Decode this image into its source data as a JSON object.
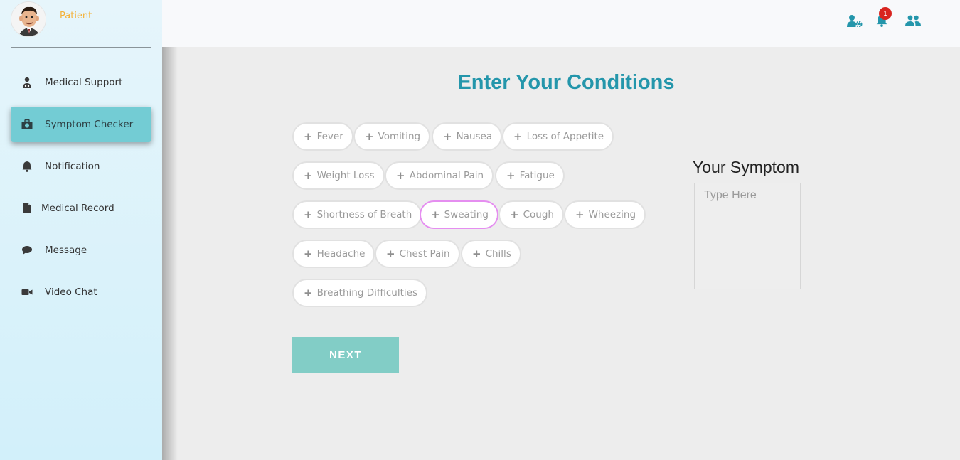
{
  "profile": {
    "name": "Patient",
    "avatar_icon": "avatar-portrait"
  },
  "sidebar": {
    "items": [
      {
        "label": "Medical Support",
        "icon": "doctor-icon"
      },
      {
        "label": "Symptom Checker",
        "icon": "medkit-icon",
        "active": true
      },
      {
        "label": "Notification",
        "icon": "bell-icon"
      },
      {
        "label": "Medical Record",
        "icon": "file-icon"
      },
      {
        "label": "Message",
        "icon": "chat-bubble-icon"
      },
      {
        "label": "Video Chat",
        "icon": "video-camera-icon"
      }
    ]
  },
  "topbar": {
    "icons": [
      "user-settings-icon",
      "bell-icon",
      "users-icon"
    ],
    "notification_count": "1"
  },
  "main": {
    "title": "Enter Your Conditions",
    "conditions": [
      "Fever",
      "Vomiting",
      "Nausea",
      "Loss of Appetite",
      "Weight Loss",
      "Abdominal Pain",
      "Fatigue",
      "Shortness of Breath",
      "Sweating",
      "Cough",
      "Wheezing",
      "Headache",
      "Chest Pain",
      "Chills",
      "Breathing Difficulties"
    ],
    "selected_condition": "Sweating",
    "next_label": "NEXT"
  },
  "symptom": {
    "label": "Your Symptom",
    "placeholder": "Type Here",
    "value": ""
  },
  "colors": {
    "accent": "#2496ab",
    "active_nav": "#73ccd4",
    "next_button": "#82cdc6",
    "badge": "#d8241f",
    "selected_chip_border": "#e58ef0",
    "profile_name": "#f4b23a"
  }
}
